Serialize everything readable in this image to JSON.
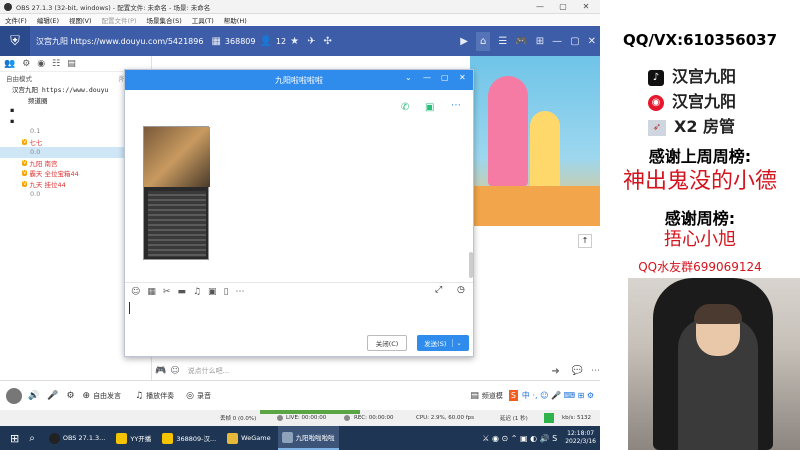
{
  "obs": {
    "title": "OBS 27.1.3 (32-bit, windows) - 配置文件: 未命名 - 场景: 未命名",
    "menu": [
      "文件(F)",
      "编辑(E)",
      "视图(V)",
      "配置文件(P)",
      "场景集合(S)",
      "工具(T)",
      "帮助(H)"
    ],
    "status": {
      "dropped": "丢帧 0 (0.0%)",
      "live": "LIVE: 00:00:00",
      "rec": "REC: 00:00:00",
      "cpu": "CPU: 2.9%, 60.00 fps",
      "delay": "延迟 (1 秒)",
      "speed": "kb/s: 5132"
    }
  },
  "yy": {
    "header": {
      "channel": "汉宫九阳 https://www.douyu.com/5421896",
      "id": "368809",
      "fans": "12"
    },
    "left": {
      "mode": "自由模式",
      "all": "所有人可",
      "tree": [
        {
          "text": "汉宫九阳 https://www.douyu",
          "indent": 1
        },
        {
          "text": "频道圈",
          "indent": 2
        },
        {
          "text": "",
          "indent": 1
        },
        {
          "text": "",
          "indent": 1
        },
        {
          "text": "0.1",
          "indent": 2
        },
        {
          "text": "七七",
          "indent": 2
        },
        {
          "text": "0.0",
          "indent": 2,
          "selected": true
        },
        {
          "text": "九阳 南宫",
          "indent": 2
        },
        {
          "text": "霸天 全位宝箱44",
          "indent": 2
        },
        {
          "text": "九天 挂位44",
          "indent": 2
        },
        {
          "text": "0.0",
          "indent": 2
        }
      ]
    },
    "input_placeholder": "说点什么吧...",
    "bottom": {
      "free_speech": "自由发言",
      "accompany": "播放伴奏",
      "record": "录音",
      "channel_mode": "频道模"
    }
  },
  "chat": {
    "title": "九阳啦啦啦啦",
    "close_label": "关闭(C)",
    "send_label": "发送(S)"
  },
  "taskbar": {
    "items": [
      "OBS 27.1.3...",
      "YY开播",
      "368809-汉...",
      "WeGame",
      "九阳啦啦啦啦"
    ],
    "time": "12:18:07",
    "date": "2022/3/16"
  },
  "overlay": {
    "contact": "QQ/VX:610356037",
    "tiktok": "汉宫九阳",
    "weibo": "汉宫九阳",
    "x2": "X2 房管",
    "thanks_last_week": "感谢上周周榜:",
    "last_week_name": "神出鬼没的小德",
    "thanks_week": "感谢周榜:",
    "week_name": "捂心小旭",
    "qq_group": "QQ水友群699069124"
  },
  "colors": {
    "yy_header": "#3d5da8",
    "chat_title": "#2f8ced",
    "taskbar": "#1e3554"
  }
}
